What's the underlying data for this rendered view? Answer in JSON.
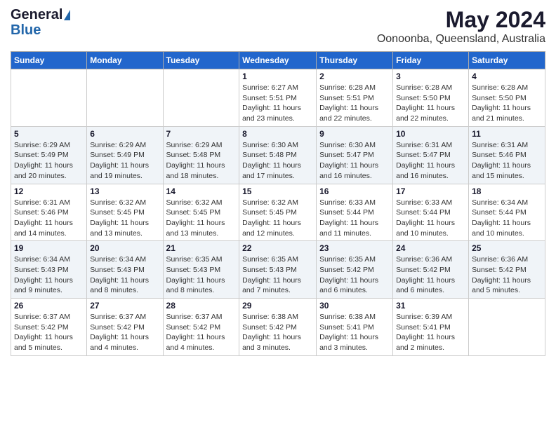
{
  "logo": {
    "general": "General",
    "blue": "Blue"
  },
  "title": "May 2024",
  "subtitle": "Oonoonba, Queensland, Australia",
  "weekdays": [
    "Sunday",
    "Monday",
    "Tuesday",
    "Wednesday",
    "Thursday",
    "Friday",
    "Saturday"
  ],
  "weeks": [
    [
      {
        "day": "",
        "info": ""
      },
      {
        "day": "",
        "info": ""
      },
      {
        "day": "",
        "info": ""
      },
      {
        "day": "1",
        "info": "Sunrise: 6:27 AM\nSunset: 5:51 PM\nDaylight: 11 hours and 23 minutes."
      },
      {
        "day": "2",
        "info": "Sunrise: 6:28 AM\nSunset: 5:51 PM\nDaylight: 11 hours and 22 minutes."
      },
      {
        "day": "3",
        "info": "Sunrise: 6:28 AM\nSunset: 5:50 PM\nDaylight: 11 hours and 22 minutes."
      },
      {
        "day": "4",
        "info": "Sunrise: 6:28 AM\nSunset: 5:50 PM\nDaylight: 11 hours and 21 minutes."
      }
    ],
    [
      {
        "day": "5",
        "info": "Sunrise: 6:29 AM\nSunset: 5:49 PM\nDaylight: 11 hours and 20 minutes."
      },
      {
        "day": "6",
        "info": "Sunrise: 6:29 AM\nSunset: 5:49 PM\nDaylight: 11 hours and 19 minutes."
      },
      {
        "day": "7",
        "info": "Sunrise: 6:29 AM\nSunset: 5:48 PM\nDaylight: 11 hours and 18 minutes."
      },
      {
        "day": "8",
        "info": "Sunrise: 6:30 AM\nSunset: 5:48 PM\nDaylight: 11 hours and 17 minutes."
      },
      {
        "day": "9",
        "info": "Sunrise: 6:30 AM\nSunset: 5:47 PM\nDaylight: 11 hours and 16 minutes."
      },
      {
        "day": "10",
        "info": "Sunrise: 6:31 AM\nSunset: 5:47 PM\nDaylight: 11 hours and 16 minutes."
      },
      {
        "day": "11",
        "info": "Sunrise: 6:31 AM\nSunset: 5:46 PM\nDaylight: 11 hours and 15 minutes."
      }
    ],
    [
      {
        "day": "12",
        "info": "Sunrise: 6:31 AM\nSunset: 5:46 PM\nDaylight: 11 hours and 14 minutes."
      },
      {
        "day": "13",
        "info": "Sunrise: 6:32 AM\nSunset: 5:45 PM\nDaylight: 11 hours and 13 minutes."
      },
      {
        "day": "14",
        "info": "Sunrise: 6:32 AM\nSunset: 5:45 PM\nDaylight: 11 hours and 13 minutes."
      },
      {
        "day": "15",
        "info": "Sunrise: 6:32 AM\nSunset: 5:45 PM\nDaylight: 11 hours and 12 minutes."
      },
      {
        "day": "16",
        "info": "Sunrise: 6:33 AM\nSunset: 5:44 PM\nDaylight: 11 hours and 11 minutes."
      },
      {
        "day": "17",
        "info": "Sunrise: 6:33 AM\nSunset: 5:44 PM\nDaylight: 11 hours and 10 minutes."
      },
      {
        "day": "18",
        "info": "Sunrise: 6:34 AM\nSunset: 5:44 PM\nDaylight: 11 hours and 10 minutes."
      }
    ],
    [
      {
        "day": "19",
        "info": "Sunrise: 6:34 AM\nSunset: 5:43 PM\nDaylight: 11 hours and 9 minutes."
      },
      {
        "day": "20",
        "info": "Sunrise: 6:34 AM\nSunset: 5:43 PM\nDaylight: 11 hours and 8 minutes."
      },
      {
        "day": "21",
        "info": "Sunrise: 6:35 AM\nSunset: 5:43 PM\nDaylight: 11 hours and 8 minutes."
      },
      {
        "day": "22",
        "info": "Sunrise: 6:35 AM\nSunset: 5:43 PM\nDaylight: 11 hours and 7 minutes."
      },
      {
        "day": "23",
        "info": "Sunrise: 6:35 AM\nSunset: 5:42 PM\nDaylight: 11 hours and 6 minutes."
      },
      {
        "day": "24",
        "info": "Sunrise: 6:36 AM\nSunset: 5:42 PM\nDaylight: 11 hours and 6 minutes."
      },
      {
        "day": "25",
        "info": "Sunrise: 6:36 AM\nSunset: 5:42 PM\nDaylight: 11 hours and 5 minutes."
      }
    ],
    [
      {
        "day": "26",
        "info": "Sunrise: 6:37 AM\nSunset: 5:42 PM\nDaylight: 11 hours and 5 minutes."
      },
      {
        "day": "27",
        "info": "Sunrise: 6:37 AM\nSunset: 5:42 PM\nDaylight: 11 hours and 4 minutes."
      },
      {
        "day": "28",
        "info": "Sunrise: 6:37 AM\nSunset: 5:42 PM\nDaylight: 11 hours and 4 minutes."
      },
      {
        "day": "29",
        "info": "Sunrise: 6:38 AM\nSunset: 5:42 PM\nDaylight: 11 hours and 3 minutes."
      },
      {
        "day": "30",
        "info": "Sunrise: 6:38 AM\nSunset: 5:41 PM\nDaylight: 11 hours and 3 minutes."
      },
      {
        "day": "31",
        "info": "Sunrise: 6:39 AM\nSunset: 5:41 PM\nDaylight: 11 hours and 2 minutes."
      },
      {
        "day": "",
        "info": ""
      }
    ]
  ]
}
